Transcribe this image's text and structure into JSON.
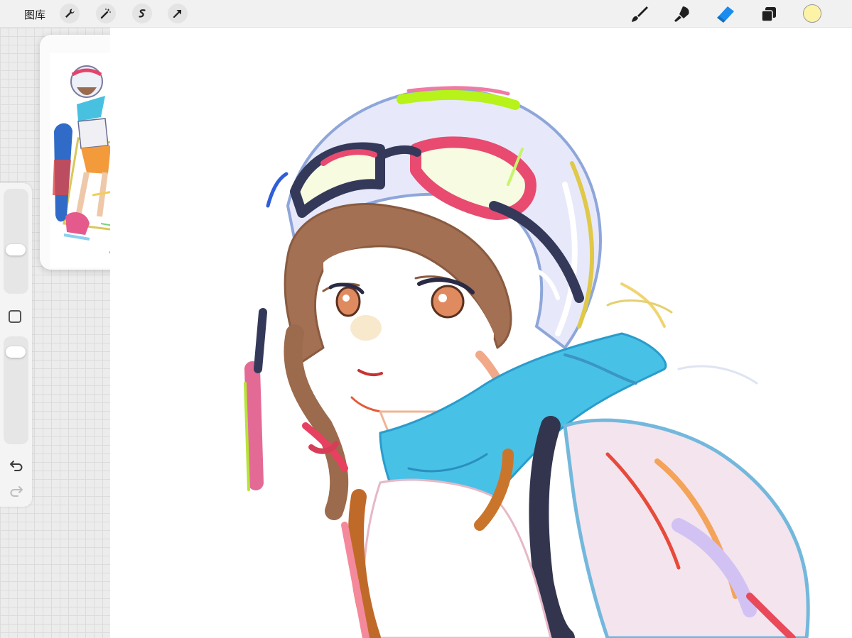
{
  "toolbar": {
    "gallery_label": "图库",
    "action_icons": [
      "wrench-icon",
      "magic-wand-icon",
      "selection-icon",
      "transform-arrow-icon"
    ],
    "tool_icons": [
      "brush-icon",
      "smudge-icon",
      "eraser-icon",
      "layers-icon"
    ],
    "active_tool": "eraser-icon",
    "current_color": "#fdf3a6"
  },
  "sidebar": {
    "brush_size_level": 0.4,
    "opacity_level": 0.92,
    "icons": [
      "modify-square-icon",
      "undo-icon",
      "redo-icon"
    ]
  },
  "colors": {
    "accent": "#1a8cf0",
    "icon_dark": "#1f1f1f",
    "panel_bg": "#f1f1f1"
  }
}
